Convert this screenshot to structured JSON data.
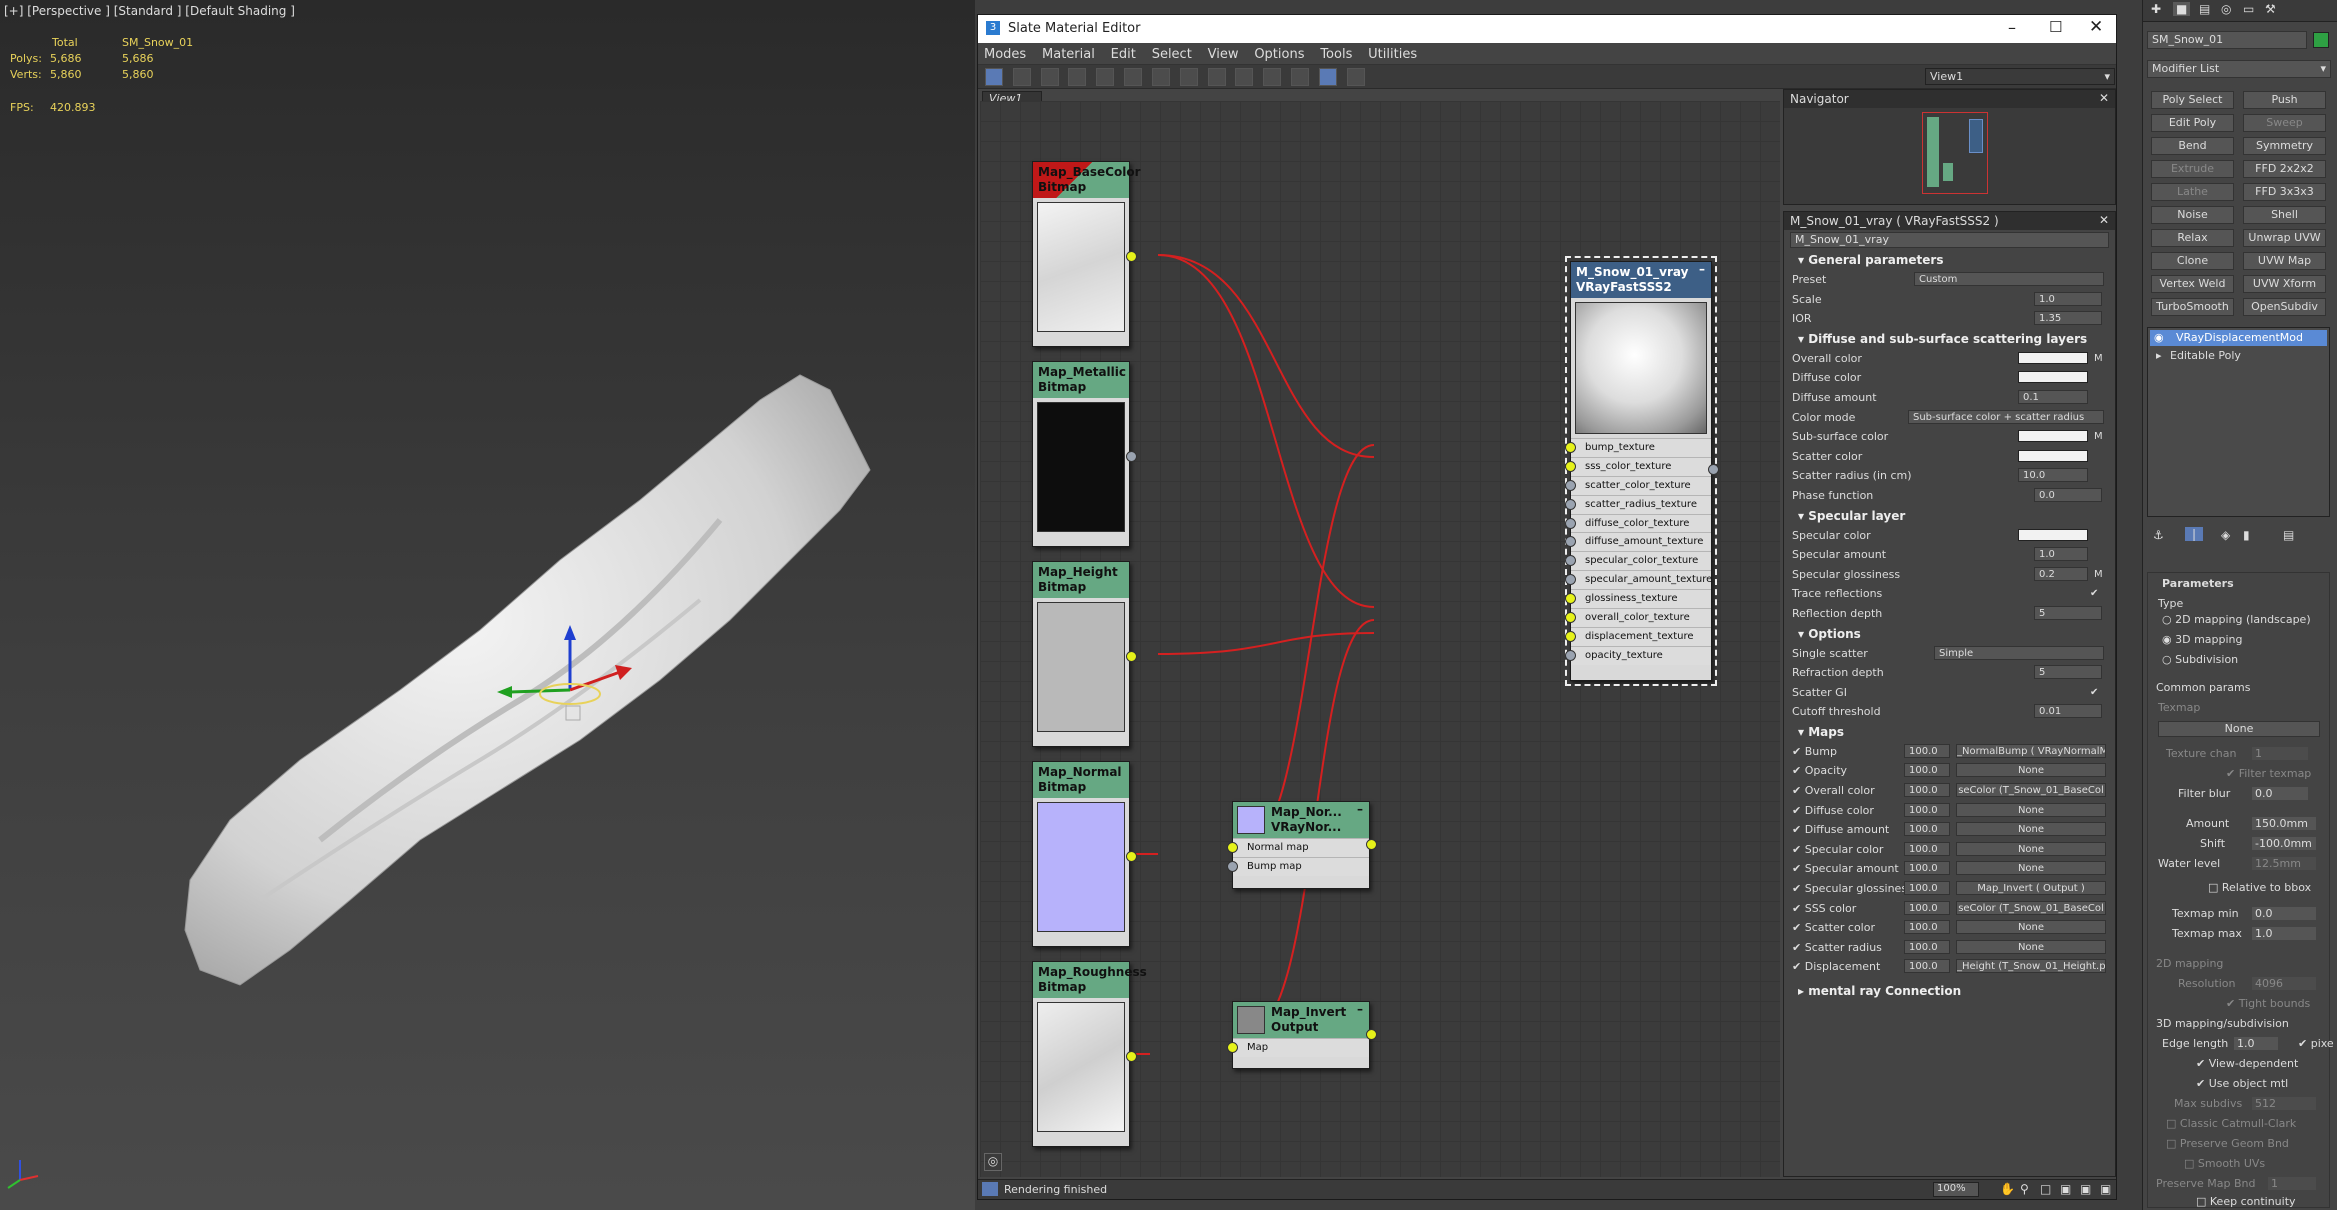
{
  "viewport": {
    "label": "[+] [Perspective ] [Standard ] [Default Shading ]",
    "stats": {
      "total_label": "Total",
      "object_name": "SM_Snow_01",
      "polys_label": "Polys:",
      "polys_total": "5,686",
      "polys_obj": "5,686",
      "verts_label": "Verts:",
      "verts_total": "5,860",
      "verts_obj": "5,860",
      "fps_label": "FPS:",
      "fps": "420.893"
    }
  },
  "editor": {
    "title": "Slate Material Editor",
    "menus": [
      "Modes",
      "Material",
      "Edit",
      "Select",
      "View",
      "Options",
      "Tools",
      "Utilities"
    ],
    "view_dropdown": "View1",
    "view_tab": "View1",
    "status": "Rendering finished",
    "zoom": "100%",
    "nodes": {
      "basecolor": {
        "title": "Map_BaseColor",
        "sub": "Bitmap"
      },
      "metallic": {
        "title": "Map_Metallic",
        "sub": "Bitmap"
      },
      "height": {
        "title": "Map_Height",
        "sub": "Bitmap"
      },
      "normal": {
        "title": "Map_Normal",
        "sub": "Bitmap"
      },
      "roughness": {
        "title": "Map_Roughness",
        "sub": "Bitmap"
      },
      "normalmap": {
        "title": "Map_Nor...",
        "sub": "VRayNor...",
        "slots": [
          "Normal map",
          "Bump map"
        ]
      },
      "invert": {
        "title": "Map_Invert",
        "sub": "Output",
        "slots": [
          "Map"
        ]
      },
      "material": {
        "title": "M_Snow_01_vray",
        "sub": "VRayFastSSS2",
        "slots": [
          "bump_texture",
          "sss_color_texture",
          "scatter_color_texture",
          "scatter_radius_texture",
          "diffuse_color_texture",
          "diffuse_amount_texture",
          "specular_color_texture",
          "specular_amount_texture",
          "glossiness_texture",
          "overall_color_texture",
          "displacement_texture",
          "opacity_texture"
        ]
      }
    },
    "navigator": {
      "title": "Navigator"
    },
    "params": {
      "header": "M_Snow_01_vray  ( VRayFastSSS2 )",
      "name": "M_Snow_01_vray",
      "general": {
        "title": "General parameters",
        "preset_label": "Preset",
        "preset": "Custom",
        "scale_label": "Scale",
        "scale": "1.0",
        "ior_label": "IOR",
        "ior": "1.35"
      },
      "diffuse": {
        "title": "Diffuse and sub-surface scattering layers",
        "overall_label": "Overall color",
        "diffuse_label": "Diffuse color",
        "amount_label": "Diffuse amount",
        "amount": "0.1",
        "mode_label": "Color mode",
        "mode": "Sub-surface color + scatter radius",
        "sub_label": "Sub-surface color",
        "scatter_label": "Scatter color",
        "radius_label": "Scatter radius (in cm)",
        "radius": "10.0",
        "phase_label": "Phase function",
        "phase": "0.0",
        "m": "M"
      },
      "specular": {
        "title": "Specular layer",
        "color_label": "Specular color",
        "amount_label": "Specular amount",
        "amount": "1.0",
        "gloss_label": "Specular glossiness",
        "gloss": "0.2",
        "trace_label": "Trace reflections",
        "depth_label": "Reflection depth",
        "depth": "5",
        "m": "M"
      },
      "options": {
        "title": "Options",
        "single_label": "Single scatter",
        "single": "Simple",
        "refr_label": "Refraction depth",
        "refr": "5",
        "gi_label": "Scatter GI",
        "cutoff_label": "Cutoff threshold",
        "cutoff": "0.01"
      },
      "maps": {
        "title": "Maps",
        "rows": [
          {
            "label": "Bump",
            "amt": "100.0",
            "map": "_NormalBump  ( VRayNormalMa"
          },
          {
            "label": "Opacity",
            "amt": "100.0",
            "map": "None"
          },
          {
            "label": "Overall color",
            "amt": "100.0",
            "map": "seColor (T_Snow_01_BaseCol"
          },
          {
            "label": "Diffuse color",
            "amt": "100.0",
            "map": "None"
          },
          {
            "label": "Diffuse amount",
            "amt": "100.0",
            "map": "None"
          },
          {
            "label": "Specular color",
            "amt": "100.0",
            "map": "None"
          },
          {
            "label": "Specular amount",
            "amt": "100.0",
            "map": "None"
          },
          {
            "label": "Specular glossiness",
            "amt": "100.0",
            "map": "Map_Invert  ( Output )"
          },
          {
            "label": "SSS color",
            "amt": "100.0",
            "map": "seColor (T_Snow_01_BaseCol"
          },
          {
            "label": "Scatter color",
            "amt": "100.0",
            "map": "None"
          },
          {
            "label": "Scatter radius",
            "amt": "100.0",
            "map": "None"
          },
          {
            "label": "Displacement",
            "amt": "100.0",
            "map": "_Height (T_Snow_01_Height.p"
          }
        ]
      },
      "mentalray": "mental ray Connection"
    }
  },
  "cmdpanel": {
    "object_name": "SM_Snow_01",
    "modifier_list": "Modifier List",
    "buttons": [
      "Poly Select",
      "Push",
      "Edit Poly",
      "Sweep",
      "Bend",
      "Symmetry",
      "Extrude",
      "FFD 2x2x2",
      "Lathe",
      "FFD 3x3x3",
      "Noise",
      "Shell",
      "Relax",
      "Unwrap UVW",
      "Clone",
      "UVW Map",
      "Vertex Weld",
      "UVW Xform",
      "TurboSmooth",
      "OpenSubdiv"
    ],
    "stack": [
      "VRayDisplacementMod",
      "Editable Poly"
    ],
    "parameters_title": "Parameters",
    "type_label": "Type",
    "type_options": [
      "2D mapping (landscape)",
      "3D mapping",
      "Subdivision"
    ],
    "common": "Common params",
    "texmap_label": "Texmap",
    "texmap": "None",
    "texture_chan_label": "Texture chan",
    "texture_chan": "1",
    "filter_texmap": "Filter texmap",
    "filter_blur_label": "Filter blur",
    "filter_blur": "0.0",
    "amount_label": "Amount",
    "amount": "150.0mm",
    "shift_label": "Shift",
    "shift": "-100.0mm",
    "water_label": "Water level",
    "water": "12.5mm",
    "relative": "Relative to bbox",
    "texmap_min_label": "Texmap min",
    "texmap_min": "0.0",
    "texmap_max_label": "Texmap max",
    "texmap_max": "1.0",
    "map2d": "2D mapping",
    "resolution_label": "Resolution",
    "resolution": "4096",
    "tight": "Tight bounds",
    "map3d": "3D mapping/subdivision",
    "edge_label": "Edge length",
    "edge": "1.0",
    "pixels": "pixe",
    "view_dep": "View-dependent",
    "use_obj": "Use object mtl",
    "max_sub_label": "Max subdivs",
    "max_sub": "512",
    "catmull": "Classic Catmull-Clark",
    "preserve_geom": "Preserve Geom Bnd",
    "smooth_uvs": "Smooth UVs",
    "preserve_map": "Preserve Map Bnd",
    "preserve_map_val": "1",
    "keep": "Keep continuity"
  }
}
